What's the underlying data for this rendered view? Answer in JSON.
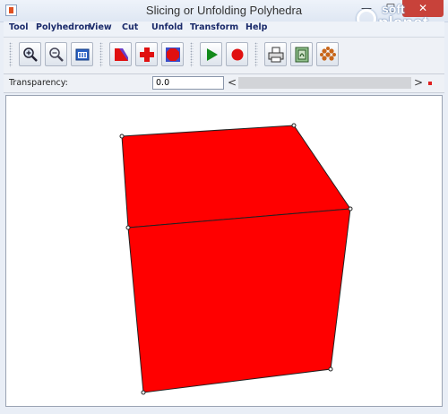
{
  "window": {
    "title": "Slicing or Unfolding Polyhedra",
    "minimize_glyph": "—",
    "maximize_glyph": "☐",
    "close_glyph": "✕"
  },
  "watermark": {
    "line1": "soft",
    "line2": "planet",
    "reg": ".net"
  },
  "menu": [
    "Tool",
    "Polyhedron",
    "View",
    "Cut",
    "Unfold",
    "Transform",
    "Help"
  ],
  "toolbar": {
    "buttons": [
      {
        "name": "zoom-in-icon"
      },
      {
        "name": "zoom-out-icon"
      },
      {
        "name": "fit-view-icon"
      },
      {
        "name": "slice-icon"
      },
      {
        "name": "cross-unfold-icon"
      },
      {
        "name": "polygon-icon"
      },
      {
        "name": "play-icon"
      },
      {
        "name": "stop-icon"
      },
      {
        "name": "print-icon"
      },
      {
        "name": "export-image-icon"
      },
      {
        "name": "net-pattern-icon"
      }
    ]
  },
  "transparency": {
    "label": "Transparency:",
    "value": "0.0",
    "scroll_left": "<",
    "scroll_right": ">"
  },
  "model": {
    "shape": "cube",
    "face_color": "#ff0000",
    "edge_color": "#222222"
  }
}
